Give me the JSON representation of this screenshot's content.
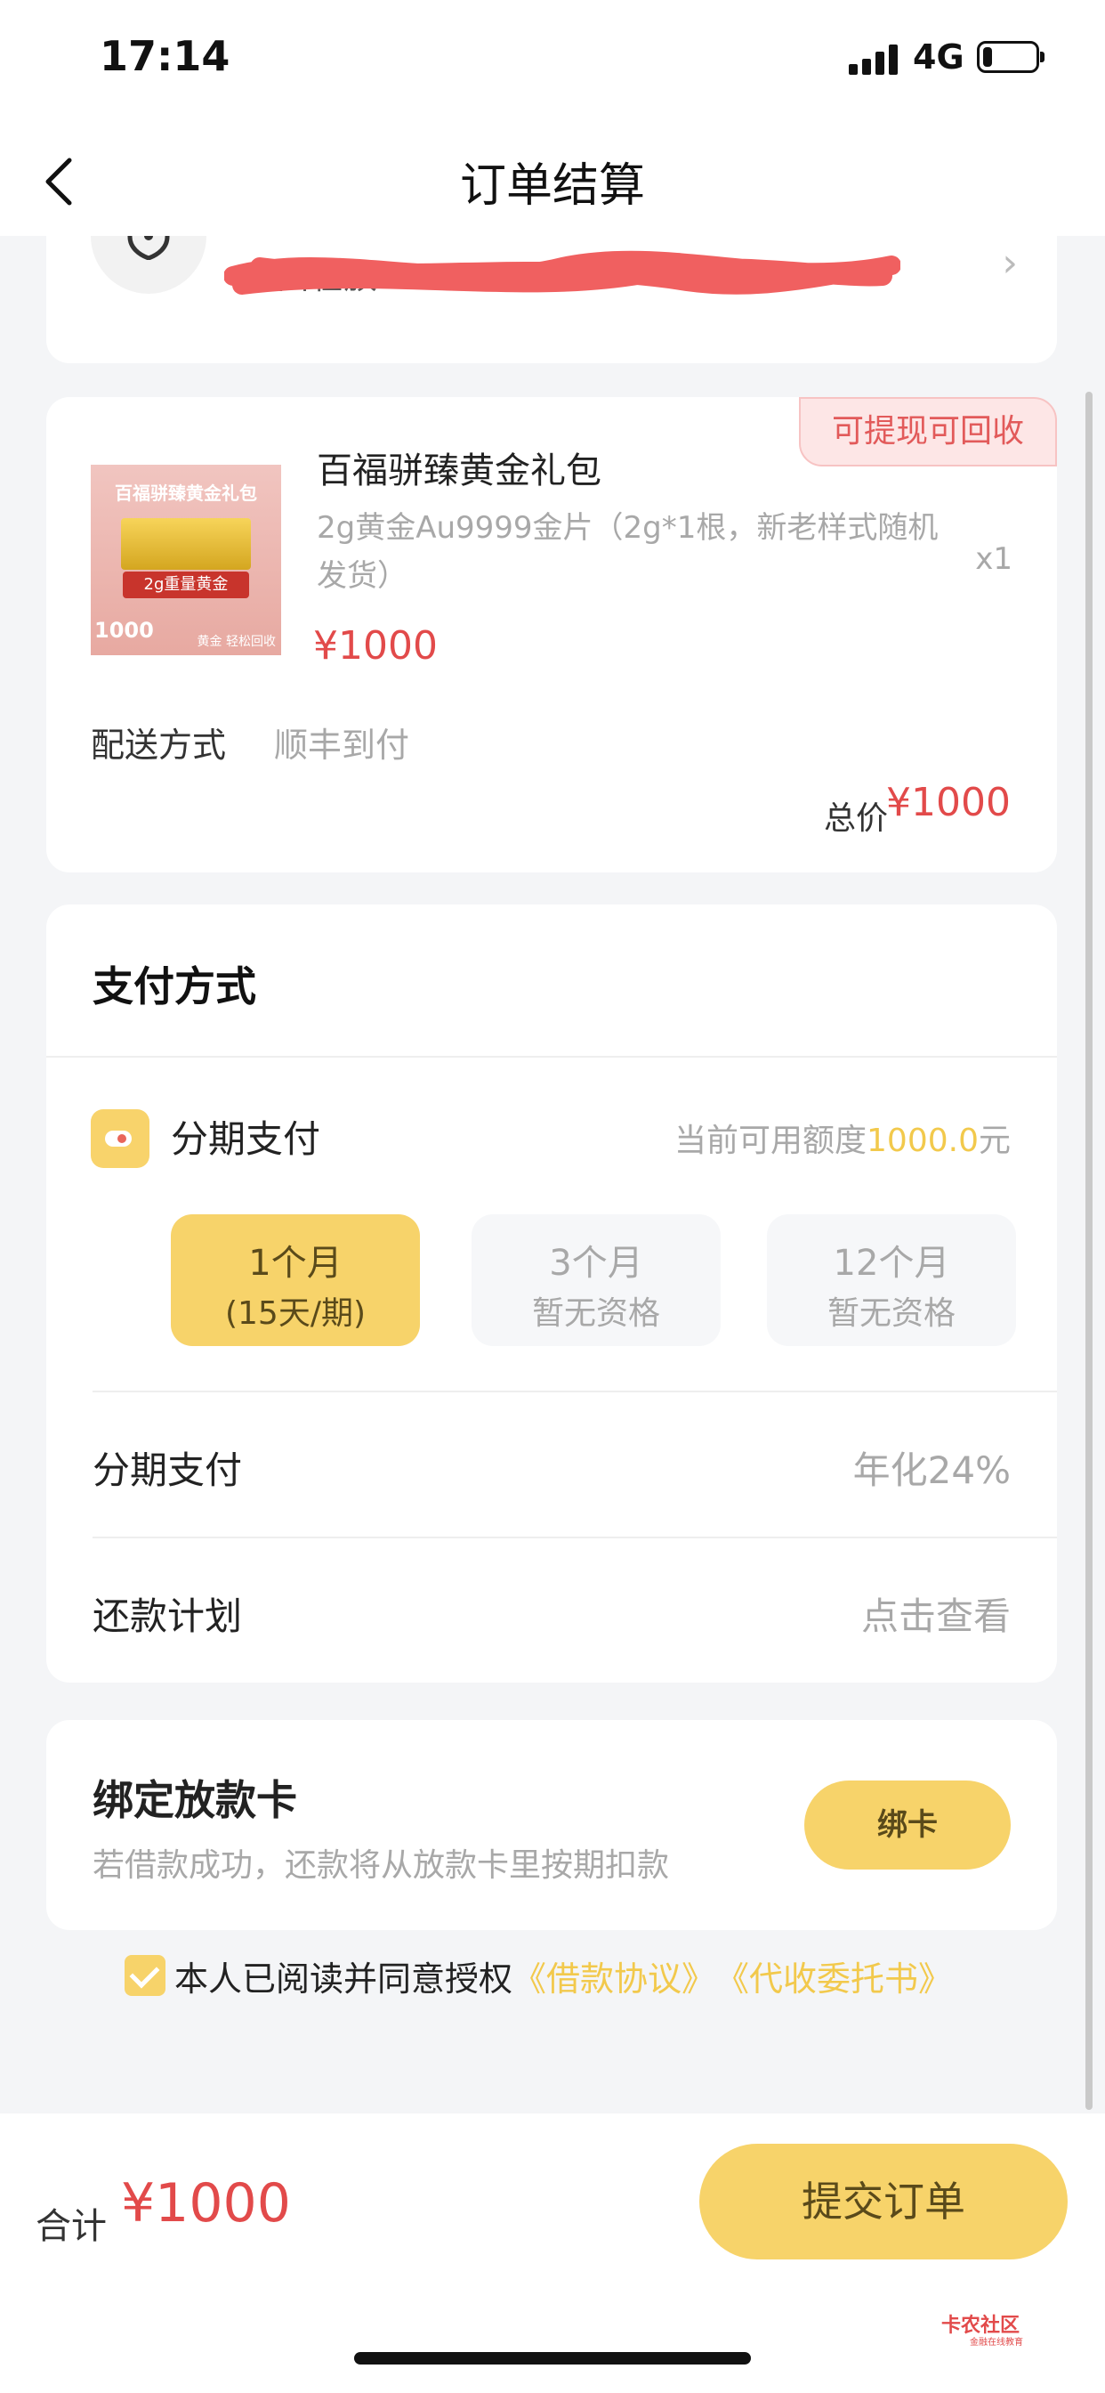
{
  "status": {
    "time": "17:14",
    "network": "4G",
    "battery_level": 0.18
  },
  "nav": {
    "title": "订单结算"
  },
  "address": {
    "text": "广西壮族"
  },
  "product": {
    "badge": "可提现可回收",
    "image_title": "百福骈臻黄金礼包",
    "image_weight": "2g重量黄金",
    "image_price": "1000",
    "image_note": "黄金 轻松回收",
    "name": "百福骈臻黄金礼包",
    "desc": "2g黄金Au9999金片（2g*1根，新老样式随机发货）",
    "qty": "x1",
    "price": "¥1000",
    "shipping_label": "配送方式",
    "shipping_value": "顺丰到付",
    "total_label": "总价",
    "total_value": "¥1000"
  },
  "payment": {
    "title": "支付方式",
    "installment_label": "分期支付",
    "quota_prefix": "当前可用额度",
    "quota_amount": "1000.0",
    "quota_suffix": "元",
    "terms": [
      {
        "line1": "1个月",
        "line2": "(15天/期)",
        "selected": true
      },
      {
        "line1": "3个月",
        "line2": "暂无资格",
        "selected": false
      },
      {
        "line1": "12个月",
        "line2": "暂无资格",
        "selected": false
      }
    ],
    "rate_label": "分期支付",
    "rate_value": "年化24%",
    "plan_label": "还款计划",
    "plan_value": "点击查看"
  },
  "bind": {
    "title": "绑定放款卡",
    "desc": "若借款成功，还款将从放款卡里按期扣款",
    "button": "绑卡"
  },
  "agreement": {
    "text": "本人已阅读并同意授权",
    "link1": "《借款协议》",
    "link2": "《代收委托书》",
    "checked": true
  },
  "footer": {
    "sum_label": "合计",
    "sum_value": "¥1000",
    "submit": "提交订单",
    "watermark": "卡农社区",
    "watermark_sub": "金融在线教育"
  },
  "colors": {
    "accent": "#f7d36a",
    "price": "#e24a4a",
    "muted": "#a8a8a8",
    "quota": "#f2c94c"
  }
}
